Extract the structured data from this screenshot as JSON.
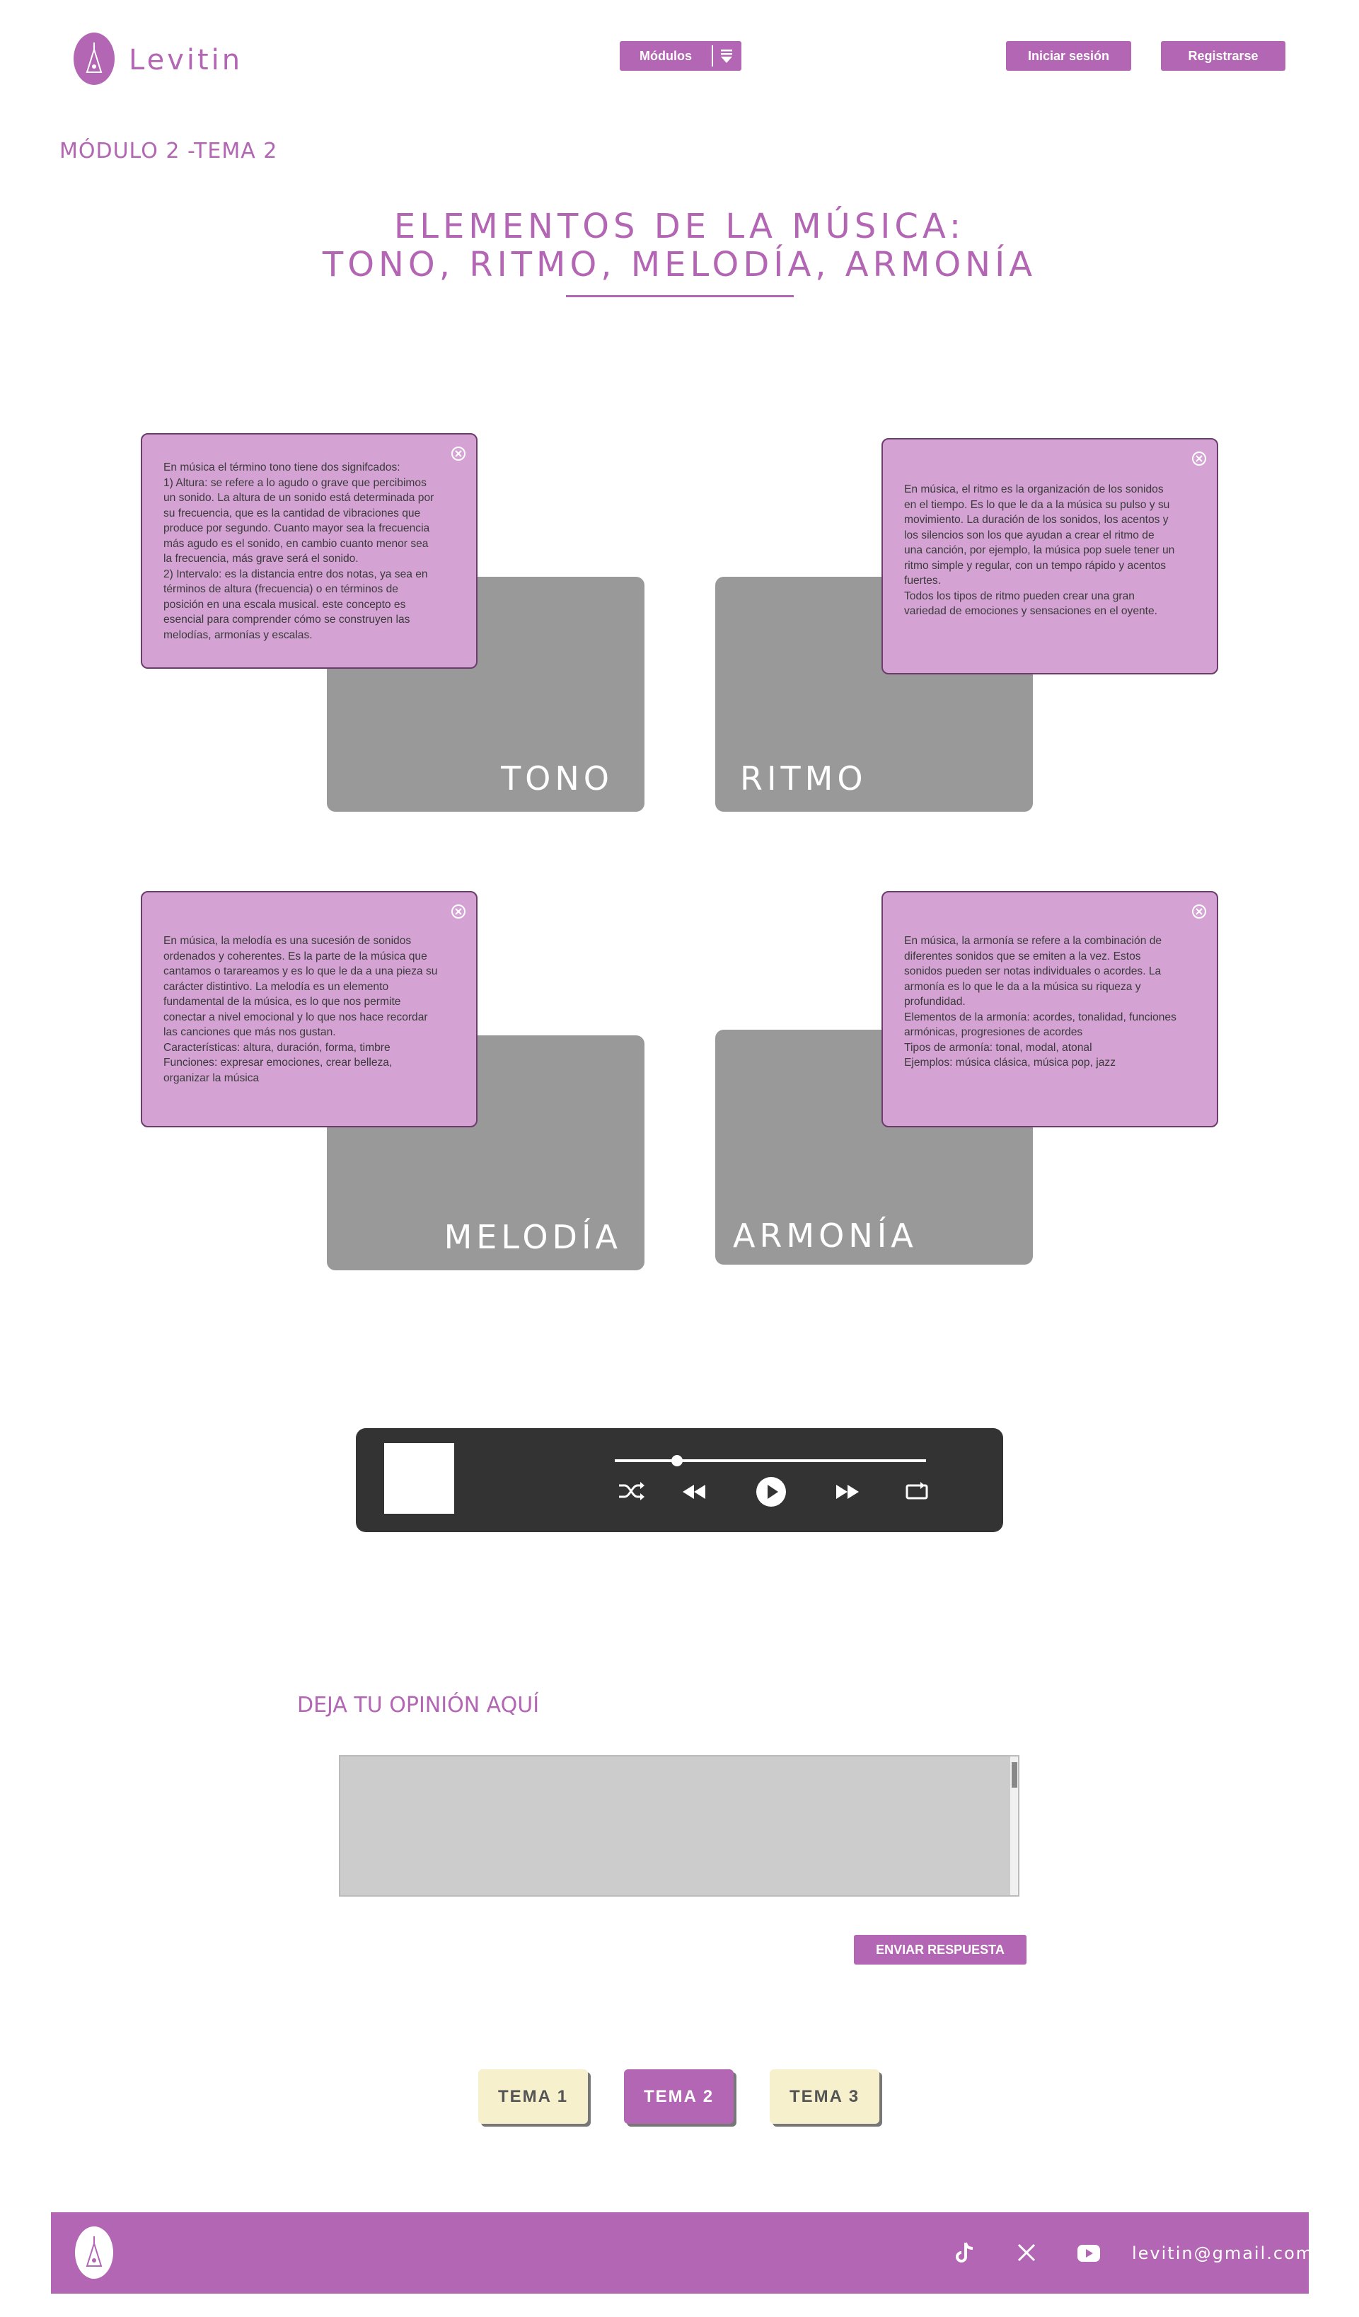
{
  "header": {
    "brand": "Levitin",
    "modules_label": "Módulos",
    "login_label": "Iniciar sesión",
    "register_label": "Registrarse",
    "logo_icon": "tuning-fork-icon"
  },
  "breadcrumb": "MÓDULO 2 -TEMA 2",
  "title": {
    "line1": "ELEMENTOS DE LA MÚSICA:",
    "line2": "TONO, RITMO, MELODÍA, ARMONÍA"
  },
  "cards": [
    {
      "label": "TONO",
      "text": "En música el término tono tiene dos signifcados:\n1) Altura: se refere a lo agudo o grave que percibimos\nun sonido. La altura de un sonido está determinada por\nsu frecuencia, que es la cantidad de vibraciones que\nproduce por segundo. Cuanto mayor sea la frecuencia\nmás agudo es el sonido, en cambio cuanto menor sea\nla frecuencia, más grave será el sonido.\n2) Intervalo: es la distancia entre dos notas, ya sea en\ntérminos de altura (frecuencia) o en términos de\nposición en una escala musical. este concepto es\nesencial para comprender cómo se construyen las\nmelodías, armonías y escalas."
    },
    {
      "label": "RITMO",
      "text": "En música, el ritmo es la organización de los sonidos\nen el tiempo. Es lo que le da a la música su pulso y su\nmovimiento. La duración de los sonidos, los acentos y\nlos silencios son los que ayudan a crear el ritmo de\nuna canción, por ejemplo, la música pop suele tener un\nritmo simple y regular, con un tempo rápido y acentos\nfuertes.\nTodos los tipos de ritmo pueden crear una gran\nvariedad de emociones y sensaciones en el oyente."
    },
    {
      "label": "MELODÍA",
      "text": "En música, la melodía es una sucesión de sonidos\nordenados y coherentes. Es la parte de la música que\ncantamos o tarareamos y es lo que le da a una pieza su\ncarácter distintivo. La melodía es un elemento\nfundamental de la música, es lo que nos permite\nconectar a nivel emocional y lo que nos hace recordar\nlas canciones que más nos gustan.\nCaracterísticas: altura, duración, forma, timbre\nFunciones: expresar emociones, crear belleza,\norganizar la música"
    },
    {
      "label": "ARMONÍA",
      "text": "En música, la armonía se refere a la combinación de\ndiferentes sonidos que se emiten a la vez. Estos\nsonidos pueden ser notas individuales o acordes. La\narmonía es lo que le da a la música su riqueza y\nprofundidad.\nElementos de la armonía: acordes, tonalidad, funciones\narmónicas, progresiones de acordes\nTipos de armonía: tonal, modal, atonal\nEjemplos: música clásica, música pop, jazz"
    }
  ],
  "player": {
    "progress": 0.2,
    "icons": [
      "shuffle-icon",
      "rewind-icon",
      "play-icon",
      "fast-forward-icon",
      "repeat-icon"
    ]
  },
  "opinion": {
    "label": "DEJA TU OPINIÓN AQUÍ",
    "value": "",
    "submit_label": "ENVIAR RESPUESTA"
  },
  "topics": [
    {
      "label": "TEMA 1",
      "active": false
    },
    {
      "label": "TEMA 2",
      "active": true
    },
    {
      "label": "TEMA 3",
      "active": false
    }
  ],
  "footer": {
    "email": "levitin@gmail.com",
    "icons": [
      "tiktok-icon",
      "x-icon",
      "youtube-icon"
    ]
  },
  "colors": {
    "accent": "#b366b3",
    "popup": "#d4a3d4",
    "card": "#999999",
    "player": "#333333",
    "topic_inactive": "#f7f0cc"
  }
}
